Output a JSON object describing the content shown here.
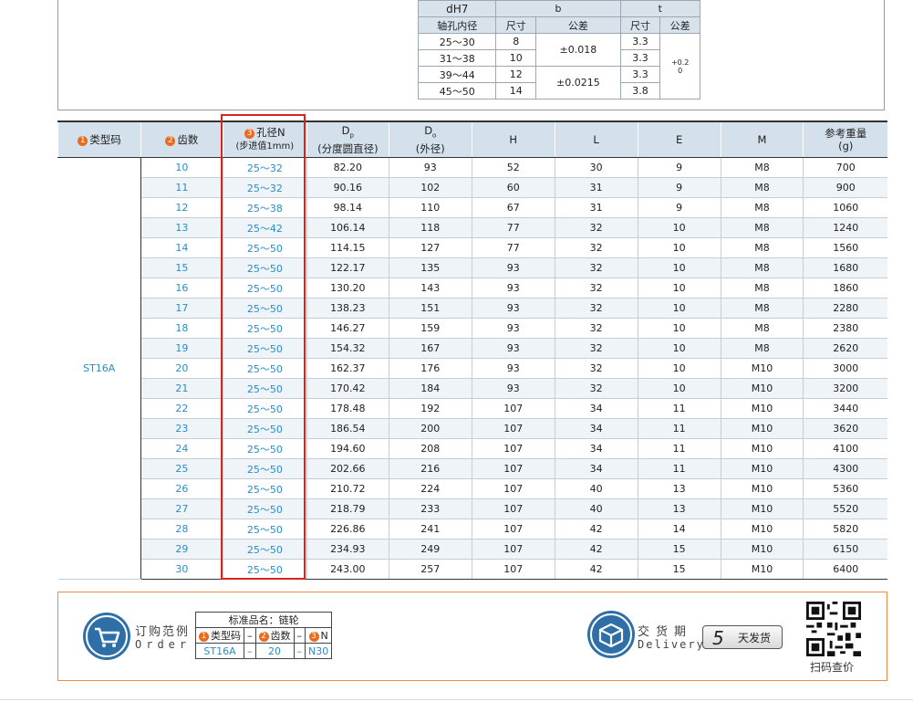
{
  "key_table": {
    "h_dh7": "dH7",
    "h_bore": "轴孔内径",
    "h_b": "b",
    "h_t": "t",
    "h_size": "尺寸",
    "h_tol": "公差",
    "rows": [
      {
        "bore": "25～30",
        "b": "8",
        "t": "3.3"
      },
      {
        "bore": "31～38",
        "b": "10",
        "t": "3.3"
      },
      {
        "bore": "39～44",
        "b": "12",
        "t": "3.3"
      },
      {
        "bore": "45～50",
        "b": "14",
        "t": "3.8"
      }
    ],
    "b_tol_1": "±0.018",
    "b_tol_2": "±0.0215",
    "t_tol_1": "+0.2",
    "t_tol_2": "0"
  },
  "main_table": {
    "headers": {
      "type_num": "1",
      "type": "类型码",
      "teeth_num": "2",
      "teeth": "齿数",
      "bore_num": "3",
      "bore": "孔径N",
      "bore_sub": "(步进值1mm)",
      "dp": "D",
      "dp_sub": "p",
      "dp_desc": "(分度圆直径)",
      "do": "D",
      "do_sub": "o",
      "do_desc": "(外径)",
      "h": "H",
      "l": "L",
      "e": "E",
      "m": "M",
      "weight": "参考重量",
      "weight_unit": "(g)"
    },
    "type_code": "ST16A",
    "rows": [
      [
        "10",
        "25～32",
        "82.20",
        "93",
        "52",
        "30",
        "9",
        "M8",
        "700"
      ],
      [
        "11",
        "25～32",
        "90.16",
        "102",
        "60",
        "31",
        "9",
        "M8",
        "900"
      ],
      [
        "12",
        "25～38",
        "98.14",
        "110",
        "67",
        "31",
        "9",
        "M8",
        "1060"
      ],
      [
        "13",
        "25～42",
        "106.14",
        "118",
        "77",
        "32",
        "10",
        "M8",
        "1240"
      ],
      [
        "14",
        "25～50",
        "114.15",
        "127",
        "77",
        "32",
        "10",
        "M8",
        "1560"
      ],
      [
        "15",
        "25～50",
        "122.17",
        "135",
        "93",
        "32",
        "10",
        "M8",
        "1680"
      ],
      [
        "16",
        "25～50",
        "130.20",
        "143",
        "93",
        "32",
        "10",
        "M8",
        "1860"
      ],
      [
        "17",
        "25～50",
        "138.23",
        "151",
        "93",
        "32",
        "10",
        "M8",
        "2280"
      ],
      [
        "18",
        "25～50",
        "146.27",
        "159",
        "93",
        "32",
        "10",
        "M8",
        "2380"
      ],
      [
        "19",
        "25～50",
        "154.32",
        "167",
        "93",
        "32",
        "10",
        "M8",
        "2620"
      ],
      [
        "20",
        "25～50",
        "162.37",
        "176",
        "93",
        "32",
        "10",
        "M10",
        "3000"
      ],
      [
        "21",
        "25～50",
        "170.42",
        "184",
        "93",
        "32",
        "10",
        "M10",
        "3200"
      ],
      [
        "22",
        "25～50",
        "178.48",
        "192",
        "107",
        "34",
        "11",
        "M10",
        "3440"
      ],
      [
        "23",
        "25～50",
        "186.54",
        "200",
        "107",
        "34",
        "11",
        "M10",
        "3620"
      ],
      [
        "24",
        "25～50",
        "194.60",
        "208",
        "107",
        "34",
        "11",
        "M10",
        "4100"
      ],
      [
        "25",
        "25～50",
        "202.66",
        "216",
        "107",
        "34",
        "11",
        "M10",
        "4300"
      ],
      [
        "26",
        "25～50",
        "210.72",
        "224",
        "107",
        "40",
        "13",
        "M10",
        "5360"
      ],
      [
        "27",
        "25～50",
        "218.79",
        "233",
        "107",
        "40",
        "13",
        "M10",
        "5520"
      ],
      [
        "28",
        "25～50",
        "226.86",
        "241",
        "107",
        "42",
        "14",
        "M10",
        "5820"
      ],
      [
        "29",
        "25～50",
        "234.93",
        "249",
        "107",
        "42",
        "15",
        "M10",
        "6150"
      ],
      [
        "30",
        "25～50",
        "243.00",
        "257",
        "107",
        "42",
        "15",
        "M10",
        "6400"
      ]
    ]
  },
  "order": {
    "title_cn": "订购范例",
    "title_en": "Order",
    "std_name": "标准品名：链轮",
    "col1_num": "1",
    "col1": "类型码",
    "col2_num": "2",
    "col2": "齿数",
    "col3_num": "3",
    "col3": "N",
    "dash": "–",
    "val1": "ST16A",
    "val2": "20",
    "val3": "N30"
  },
  "delivery": {
    "title_cn": "交货期",
    "title_en": "Delivery",
    "days": "5",
    "days_label": "天发货"
  },
  "qr": {
    "label": "扫码查价"
  },
  "colors": {
    "accent_blue": "#2a8dc6",
    "highlight_red": "#d8241d",
    "header_bg": "#d4e1ec",
    "badge_orange": "#ea6b1e",
    "icon_blue": "#2f6fa8"
  }
}
